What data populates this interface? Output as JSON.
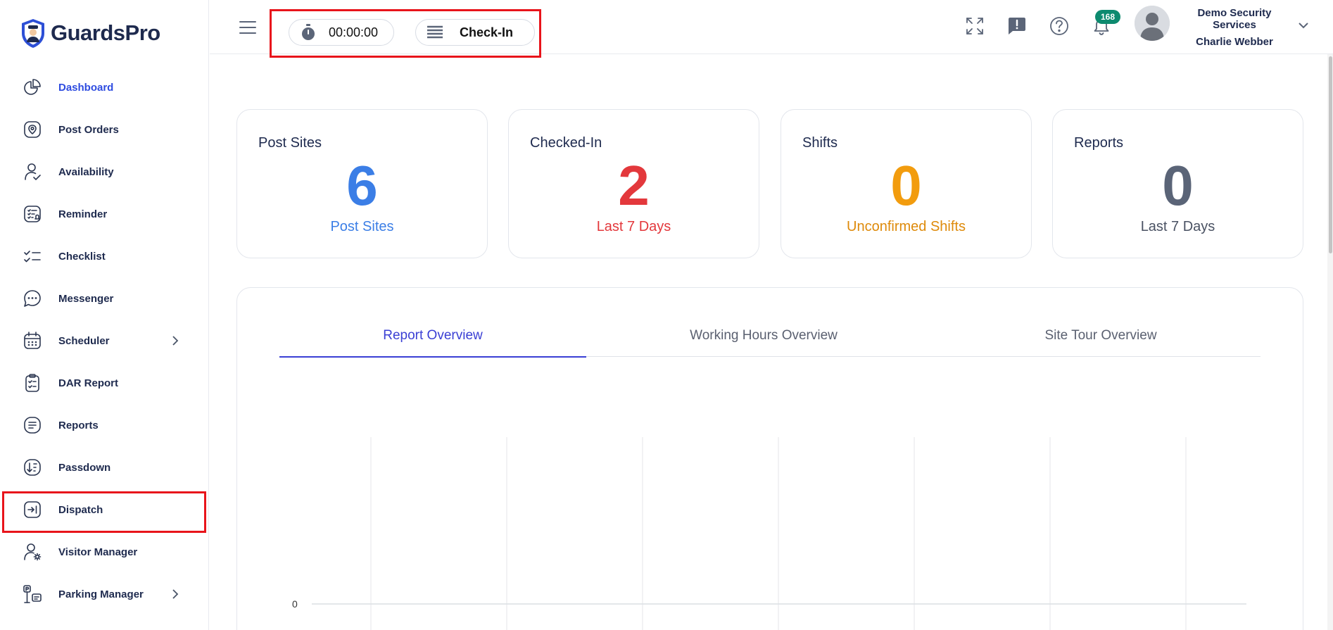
{
  "app": {
    "name": "GuardsPro"
  },
  "sidebar": {
    "items": [
      {
        "label": "Dashboard",
        "icon": "pie-chart-icon",
        "active": true
      },
      {
        "label": "Post Orders",
        "icon": "location-pin-icon"
      },
      {
        "label": "Availability",
        "icon": "user-check-icon"
      },
      {
        "label": "Reminder",
        "icon": "reminder-list-icon"
      },
      {
        "label": "Checklist",
        "icon": "checklist-icon"
      },
      {
        "label": "Messenger",
        "icon": "chat-bubble-icon"
      },
      {
        "label": "Scheduler",
        "icon": "calendar-icon",
        "has_submenu": true
      },
      {
        "label": "DAR Report",
        "icon": "clipboard-check-icon"
      },
      {
        "label": "Reports",
        "icon": "document-lines-icon"
      },
      {
        "label": "Passdown",
        "icon": "sort-down-icon"
      },
      {
        "label": "Dispatch",
        "icon": "dispatch-arrow-icon",
        "highlighted": true
      },
      {
        "label": "Visitor Manager",
        "icon": "user-gear-icon"
      },
      {
        "label": "Parking Manager",
        "icon": "parking-icon",
        "has_submenu": true
      }
    ]
  },
  "header": {
    "timer": "00:00:00",
    "check_in_label": "Check-In",
    "notification_count": "168",
    "user_org": "Demo Security Services",
    "user_name": "Charlie Webber"
  },
  "cards": [
    {
      "title": "Post Sites",
      "value": "6",
      "subtitle": "Post Sites",
      "color": "#3b7ee6"
    },
    {
      "title": "Checked-In",
      "value": "2",
      "subtitle": "Last 7 Days",
      "color": "#e3383c"
    },
    {
      "title": "Shifts",
      "value": "0",
      "subtitle": "Unconfirmed Shifts",
      "color": "#f29c0e",
      "subtitle_color": "#de8a0a"
    },
    {
      "title": "Reports",
      "value": "0",
      "subtitle": "Last 7 Days",
      "color": "#5a6477",
      "subtitle_color": "#4a5263"
    }
  ],
  "overview": {
    "tabs": [
      {
        "label": "Report Overview",
        "active": true
      },
      {
        "label": "Working Hours Overview"
      },
      {
        "label": "Site Tour Overview"
      }
    ],
    "y_tick": "0"
  },
  "colors": {
    "accent": "#2e4ce0",
    "tab_active": "#3a3fd4",
    "highlight": "#e8141b",
    "badge": "#0d8a6f"
  }
}
